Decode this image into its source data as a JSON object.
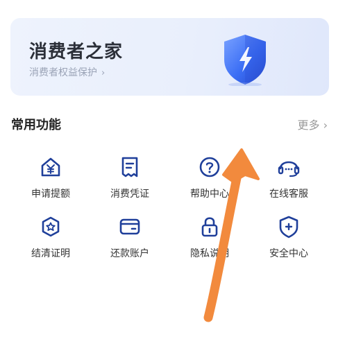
{
  "banner": {
    "title": "消费者之家",
    "subtitle": "消费者权益保护",
    "subtitle_chevron": "›",
    "icon": "shield-lightning-icon"
  },
  "section": {
    "title": "常用功能",
    "more": "更多 ›"
  },
  "functions": [
    {
      "label": "申请提额",
      "icon": "house-yen-icon"
    },
    {
      "label": "消费凭证",
      "icon": "receipt-icon"
    },
    {
      "label": "帮助中心",
      "icon": "help-circle-icon"
    },
    {
      "label": "在线客服",
      "icon": "headset-icon"
    },
    {
      "label": "结清证明",
      "icon": "badge-star-icon"
    },
    {
      "label": "还款账户",
      "icon": "wallet-card-icon"
    },
    {
      "label": "隐私说明",
      "icon": "lock-icon"
    },
    {
      "label": "安全中心",
      "icon": "shield-plus-icon"
    }
  ],
  "colors": {
    "accent": "#2f6bff",
    "icon_stroke": "#1f3f9a",
    "arrow": "#f28a3d"
  }
}
